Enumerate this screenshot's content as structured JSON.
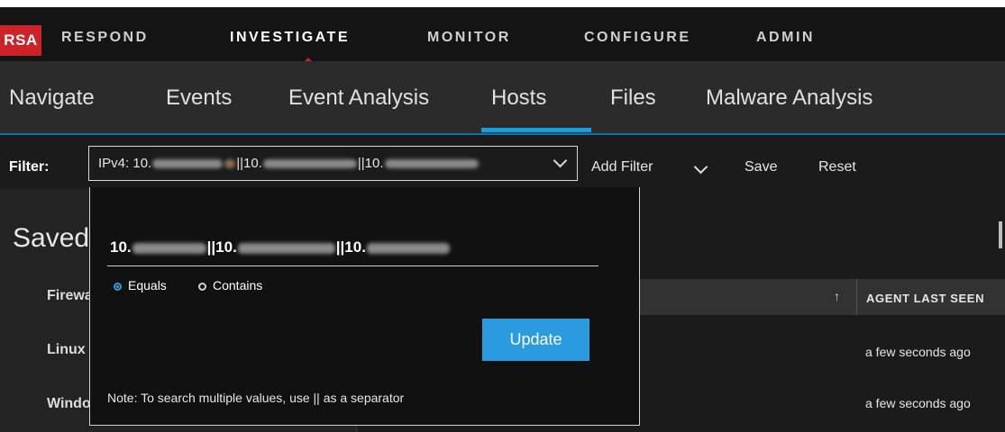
{
  "brand": {
    "logo": "RSA"
  },
  "top_nav": [
    "RESPOND",
    "INVESTIGATE",
    "MONITOR",
    "CONFIGURE",
    "ADMIN"
  ],
  "sub_nav": [
    "Navigate",
    "Events",
    "Event Analysis",
    "Hosts",
    "Files",
    "Malware Analysis"
  ],
  "filter": {
    "label": "Filter:",
    "pill_prefix": "IPv4: 10.",
    "sep1": "||10.",
    "sep2": "||10.",
    "add_filter": "Add Filter",
    "save": "Save",
    "reset": "Reset"
  },
  "popup": {
    "input_prefix": "10.",
    "sep1": "||10.",
    "sep2": "||10.",
    "radio_equals": "Equals",
    "radio_contains": "Contains",
    "update": "Update",
    "note": "Note: To search multiple values, use || as a separator"
  },
  "left_panel": {
    "title": "Saved Queries",
    "items": [
      "Firewall",
      "Linux",
      "Windows"
    ]
  },
  "table": {
    "column_header": "AGENT LAST SEEN",
    "rows": [
      "a few seconds ago",
      "a few seconds ago"
    ]
  }
}
